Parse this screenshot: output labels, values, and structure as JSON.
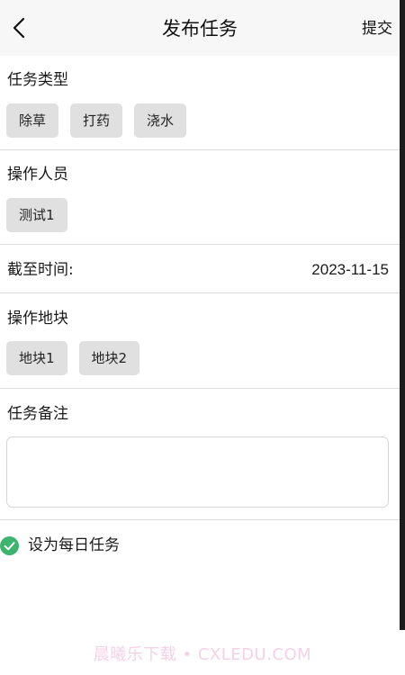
{
  "header": {
    "title": "发布任务",
    "submit_label": "提交"
  },
  "task_type": {
    "label": "任务类型",
    "options": [
      "除草",
      "打药",
      "浇水"
    ]
  },
  "operators": {
    "label": "操作人员",
    "options": [
      "测试1"
    ]
  },
  "deadline": {
    "label": "截至时间:",
    "value": "2023-11-15"
  },
  "plots": {
    "label": "操作地块",
    "options": [
      "地块1",
      "地块2"
    ]
  },
  "remark": {
    "label": "任务备注",
    "value": ""
  },
  "daily_task": {
    "label": "设为每日任务",
    "checked": true,
    "check_color": "#3cb46e"
  },
  "watermark": {
    "text": "晨曦乐下载 • CXLEDU.COM"
  },
  "icons": {
    "back": "chevron-left-icon",
    "check": "check-circle-icon"
  }
}
